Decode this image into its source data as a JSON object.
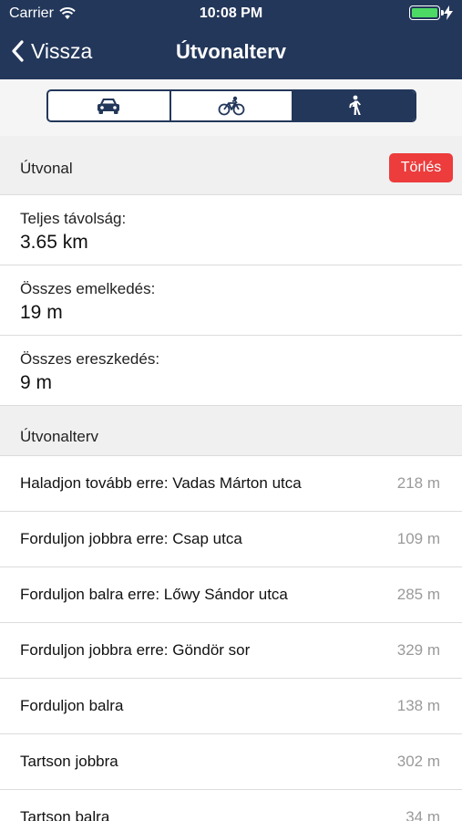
{
  "status_bar": {
    "carrier": "Carrier",
    "time": "10:08 PM"
  },
  "nav": {
    "back_label": "Vissza",
    "title": "Útvonalterv",
    "background": "#23375a"
  },
  "mode_selector": {
    "options": [
      {
        "icon": "car-icon",
        "selected": false
      },
      {
        "icon": "bicycle-icon",
        "selected": false
      },
      {
        "icon": "walking-icon",
        "selected": true
      }
    ]
  },
  "route_section": {
    "header": "Útvonal",
    "delete_label": "Törlés",
    "delete_color": "#ec3c3c"
  },
  "stats": [
    {
      "label": "Teljes távolság:",
      "value": "3.65 km"
    },
    {
      "label": "Összes emelkedés:",
      "value": "19 m"
    },
    {
      "label": "Összes ereszkedés:",
      "value": "9 m"
    }
  ],
  "plan_section": {
    "header": "Útvonalterv"
  },
  "steps": [
    {
      "instruction": "Haladjon tovább erre: Vadas Márton utca",
      "distance": "218 m"
    },
    {
      "instruction": "Forduljon jobbra erre: Csap utca",
      "distance": "109 m"
    },
    {
      "instruction": "Forduljon balra erre: Lőwy Sándor utca",
      "distance": "285 m"
    },
    {
      "instruction": "Forduljon jobbra erre: Göndör sor",
      "distance": "329 m"
    },
    {
      "instruction": "Forduljon balra",
      "distance": "138 m"
    },
    {
      "instruction": "Tartson jobbra",
      "distance": "302 m"
    },
    {
      "instruction": "Tartson balra",
      "distance": "34 m"
    }
  ]
}
